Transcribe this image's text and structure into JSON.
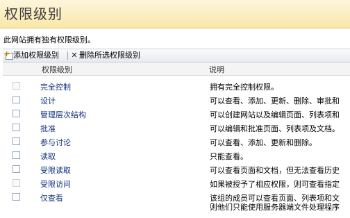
{
  "page": {
    "title": "权限级别",
    "description": "此网站拥有独有权限级别。"
  },
  "toolbar": {
    "add_label": "添加权限级别",
    "delete_label": "删除所选权限级别"
  },
  "grid": {
    "columns": {
      "level": "权限级别",
      "description": "说明"
    },
    "rows": [
      {
        "name": "完全控制",
        "description": "拥有完全控制权限。",
        "selectable": false
      },
      {
        "name": "设计",
        "description": "可以查看、添加、更新、删除、审批和",
        "selectable": true
      },
      {
        "name": "管理层次结构",
        "description": "可以创建网站以及编辑页面、列表项和",
        "selectable": true
      },
      {
        "name": "批准",
        "description": "可以编辑和批准页面、列表项及文档。",
        "selectable": true
      },
      {
        "name": "参与讨论",
        "description": "可以查看、添加、更新和删除。",
        "selectable": true
      },
      {
        "name": "读取",
        "description": "只能查看。",
        "selectable": true
      },
      {
        "name": "受限读取",
        "description": "可以查看页面和文档，但无法查看历史",
        "selectable": true
      },
      {
        "name": "受限访问",
        "description": "如果被授予了相应权限，则可查看指定",
        "selectable": false
      },
      {
        "name": "仅查看",
        "description": "该组的成员可以查看页面、列表项和文",
        "description_line2": "则他们只能使用服务器端文件处理程序",
        "selectable": true
      }
    ]
  }
}
